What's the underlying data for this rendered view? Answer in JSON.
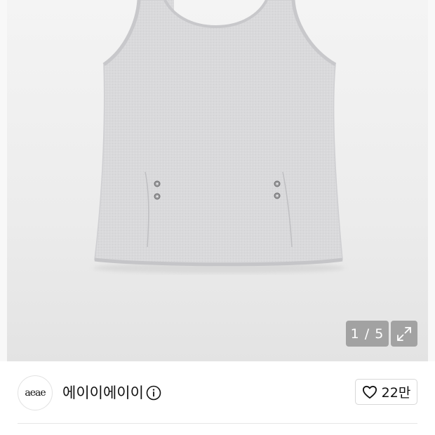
{
  "gallery": {
    "counter": "1 / 5",
    "background_color": "#ececec",
    "expand_icon": "expand-arrows-icon"
  },
  "brand": {
    "logo_text": "aeae",
    "name": "에이이에이이",
    "info_icon": "info-icon"
  },
  "like": {
    "icon": "heart-outline-icon",
    "count": "22만"
  }
}
